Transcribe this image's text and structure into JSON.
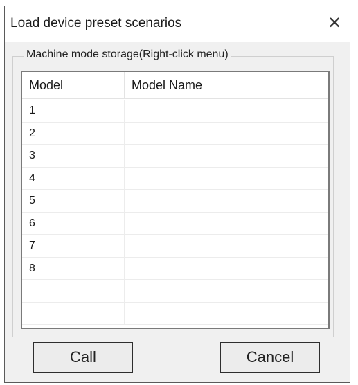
{
  "dialog": {
    "title": "Load device preset scenarios",
    "close_glyph": "✕"
  },
  "group": {
    "legend": "Machine mode storage(Right-click menu)"
  },
  "table": {
    "columns": [
      "Model",
      "Model Name"
    ],
    "rows": [
      [
        "1",
        ""
      ],
      [
        "2",
        ""
      ],
      [
        "3",
        ""
      ],
      [
        "4",
        ""
      ],
      [
        "5",
        ""
      ],
      [
        "6",
        ""
      ],
      [
        "7",
        ""
      ],
      [
        "8",
        ""
      ],
      [
        "",
        ""
      ],
      [
        "",
        ""
      ]
    ]
  },
  "buttons": {
    "call": "Call",
    "cancel": "Cancel"
  }
}
